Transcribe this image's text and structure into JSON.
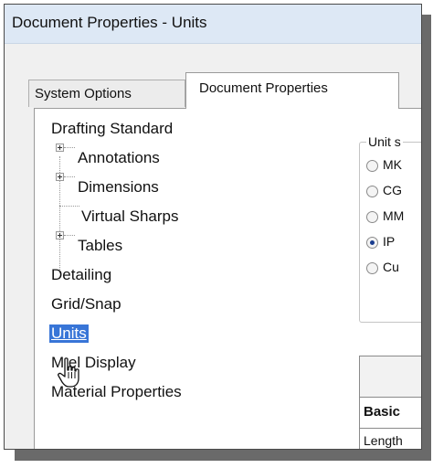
{
  "window": {
    "title": "Document Properties - Units"
  },
  "tabs": [
    {
      "label": "System Options",
      "active": false
    },
    {
      "label": "Document Properties",
      "active": true
    }
  ],
  "tree": {
    "items": [
      {
        "label": "Drafting Standard",
        "level": 0
      },
      {
        "label": "Annotations",
        "level": 1,
        "expandable": true
      },
      {
        "label": "Dimensions",
        "level": 1,
        "expandable": true
      },
      {
        "label": "Virtual Sharps",
        "level": 1,
        "expandable": false
      },
      {
        "label": "Tables",
        "level": 1,
        "expandable": true
      },
      {
        "label": "Detailing",
        "level": 0
      },
      {
        "label": "Grid/Snap",
        "level": 0
      },
      {
        "label": "Units",
        "level": 0,
        "selected": true
      },
      {
        "label": "M   el Display",
        "level": 0
      },
      {
        "label": "Material Properties",
        "level": 0
      }
    ]
  },
  "unit_system": {
    "label": "Unit s",
    "options": [
      {
        "label": "MK",
        "checked": false
      },
      {
        "label": "CG",
        "checked": false
      },
      {
        "label": "MM",
        "checked": false
      },
      {
        "label": "IP",
        "checked": true
      },
      {
        "label": "Cu",
        "checked": false
      }
    ]
  },
  "units_table": {
    "row_header": "Basic",
    "row_label": "Length"
  },
  "colors": {
    "selection": "#3875d7",
    "titlebar": "#dde8f5",
    "radio_dot": "#1a3d8f"
  }
}
